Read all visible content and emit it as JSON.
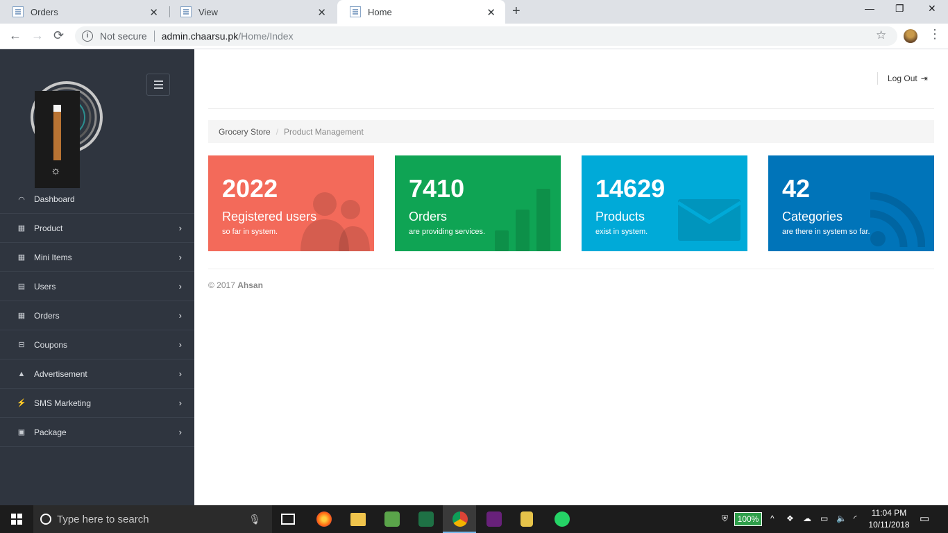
{
  "browser": {
    "tabs": [
      {
        "label": "Orders"
      },
      {
        "label": "View"
      },
      {
        "label": "Home"
      }
    ],
    "new_tab": "+",
    "window_controls": {
      "minimize": "—",
      "maximize": "❐",
      "close": "✕"
    },
    "nav": {
      "back": "←",
      "forward": "→",
      "reload": "⟳"
    },
    "security_label": "Not secure",
    "url_host": "admin.chaarsu.pk",
    "url_path": "/Home/Index",
    "star": "☆",
    "menu": "⋮"
  },
  "sidebar": {
    "items": [
      {
        "label": "Dashboard",
        "icon": "dashboard-icon",
        "glyph": "◠",
        "has_arrow": false
      },
      {
        "label": "Product",
        "icon": "grid-icon",
        "glyph": "▦",
        "has_arrow": true
      },
      {
        "label": "Mini Items",
        "icon": "grid-icon",
        "glyph": "▦",
        "has_arrow": true
      },
      {
        "label": "Users",
        "icon": "list-icon",
        "glyph": "▤",
        "has_arrow": true
      },
      {
        "label": "Orders",
        "icon": "grid-icon",
        "glyph": "▦",
        "has_arrow": true
      },
      {
        "label": "Coupons",
        "icon": "coupon-icon",
        "glyph": "⊟",
        "has_arrow": true
      },
      {
        "label": "Advertisement",
        "icon": "warning-icon",
        "glyph": "▲",
        "has_arrow": true
      },
      {
        "label": "SMS Marketing",
        "icon": "bolt-icon",
        "glyph": "⚡",
        "has_arrow": true
      },
      {
        "label": "Package",
        "icon": "package-icon",
        "glyph": "▣",
        "has_arrow": true
      }
    ],
    "arrow_glyph": "›"
  },
  "header": {
    "logout_label": "Log Out",
    "logout_icon": "⇥"
  },
  "breadcrumb": {
    "crumb1": "Grocery Store",
    "separator": "/",
    "crumb2": "Product Management"
  },
  "stats": [
    {
      "value": "2022",
      "title": "Registered users",
      "sub": "so far in system.",
      "color": "#f36a5a",
      "icon": "users-icon"
    },
    {
      "value": "7410",
      "title": "Orders",
      "sub": "are providing services.",
      "color": "#0fa454",
      "icon": "bar-chart-icon"
    },
    {
      "value": "14629",
      "title": "Products",
      "sub": "exist in system.",
      "color": "#00aad8",
      "icon": "envelope-icon"
    },
    {
      "value": "42",
      "title": "Categories",
      "sub": "are there in system so far.",
      "color": "#0074b9",
      "icon": "rss-icon"
    }
  ],
  "footer": {
    "copyright": "© 2017",
    "author": "Ahsan"
  },
  "taskbar": {
    "search_placeholder": "Type here to search",
    "battery": "100%",
    "time": "11:04 PM",
    "date": "10/11/2018"
  }
}
